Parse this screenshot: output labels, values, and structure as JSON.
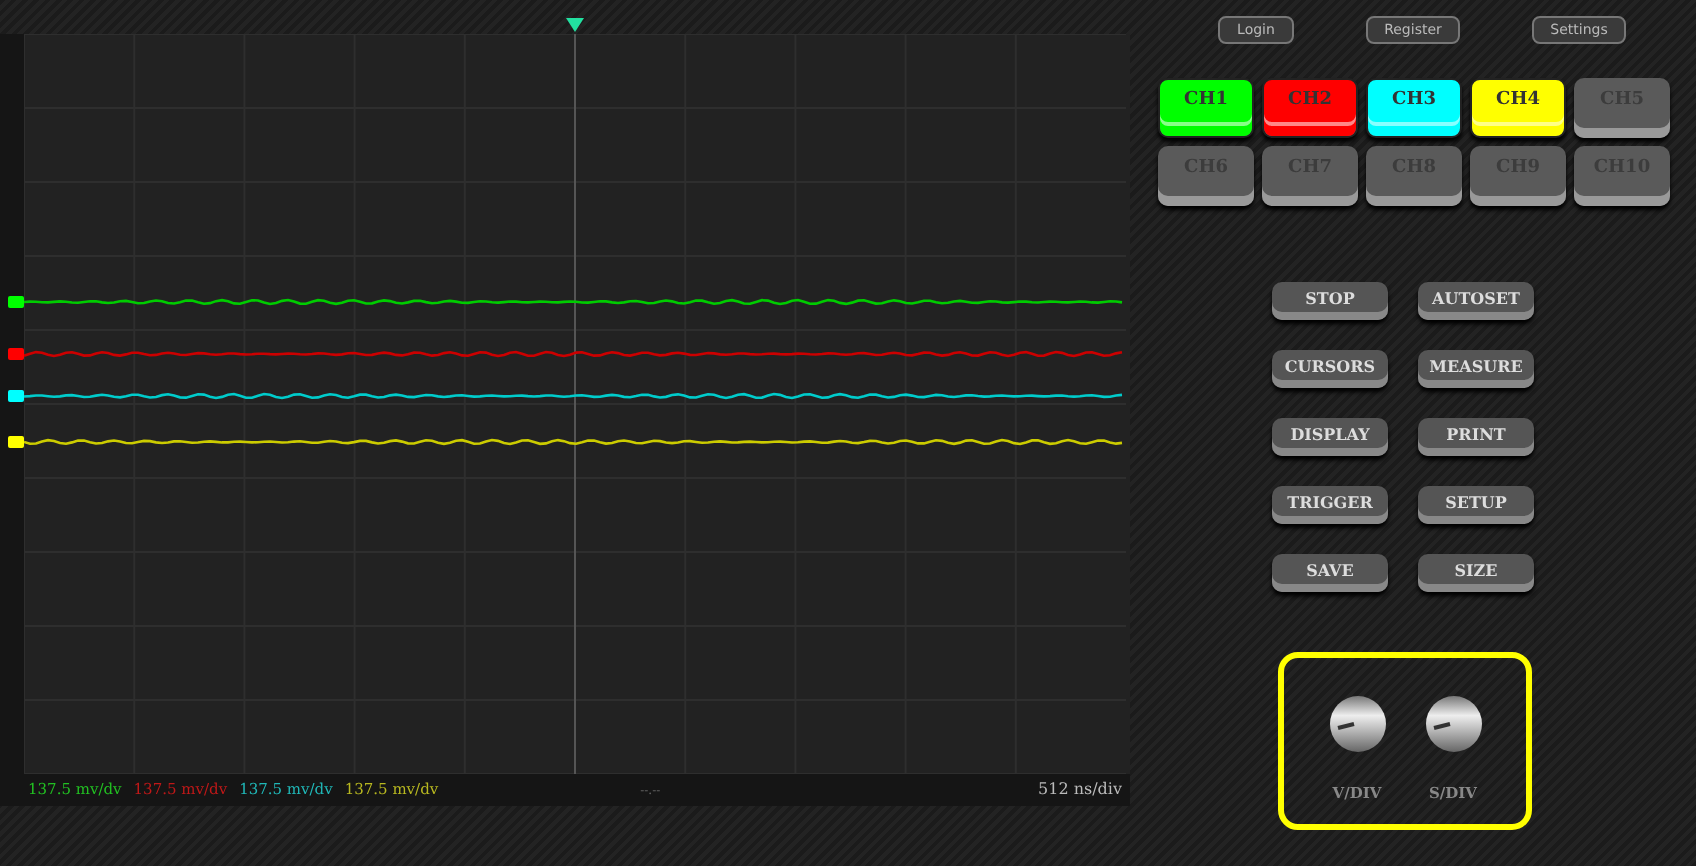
{
  "header_buttons": [
    "Login",
    "Register",
    "Settings"
  ],
  "channels": [
    {
      "label": "CH1",
      "on": true,
      "color": "#00ff00"
    },
    {
      "label": "CH2",
      "on": true,
      "color": "#ff0000"
    },
    {
      "label": "CH3",
      "on": true,
      "color": "#00ffff"
    },
    {
      "label": "CH4",
      "on": true,
      "color": "#ffff00"
    },
    {
      "label": "CH5",
      "on": false,
      "color": "#5a5a5a"
    },
    {
      "label": "CH6",
      "on": false,
      "color": "#5a5a5a"
    },
    {
      "label": "CH7",
      "on": false,
      "color": "#5a5a5a"
    },
    {
      "label": "CH8",
      "on": false,
      "color": "#5a5a5a"
    },
    {
      "label": "CH9",
      "on": false,
      "color": "#5a5a5a"
    },
    {
      "label": "CH10",
      "on": false,
      "color": "#5a5a5a"
    }
  ],
  "controls": [
    "STOP",
    "AUTOSET",
    "CURSORS",
    "MEASURE",
    "DISPLAY",
    "PRINT",
    "TRIGGER",
    "SETUP",
    "SAVE",
    "SIZE"
  ],
  "scope": {
    "readings": [
      {
        "text": "137.5 mv/dv",
        "color": "#22c022"
      },
      {
        "text": "137.5 mv/dv",
        "color": "#c01818"
      },
      {
        "text": "137.5 mv/dv",
        "color": "#20b8b8"
      },
      {
        "text": "137.5 mv/dv",
        "color": "#b8b820"
      }
    ],
    "center_reading": "--.--",
    "timebase": "512 ns/div"
  },
  "knobs": [
    {
      "label": "V/DIV"
    },
    {
      "label": "S/DIV"
    }
  ]
}
